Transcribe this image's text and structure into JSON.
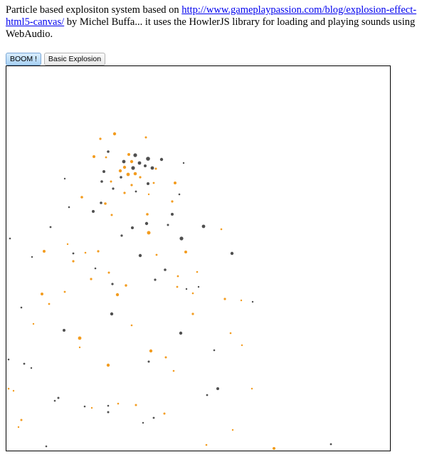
{
  "intro": {
    "text_before": "Particle based explositon system based on ",
    "link_text": "http://www.gameplaypassion.com/blog/explosion-effect-html5-canvas/",
    "text_after": " by Michel Buffa... it uses the HowlerJS library for loading and playing sounds using WebAudio."
  },
  "buttons": {
    "boom_label": "BOOM !",
    "basic_label": "Basic Explosion"
  },
  "colors": {
    "orange_particle": "#f39c1f",
    "dark_particle": "#505050",
    "button_accent": "#a9d2f5"
  }
}
